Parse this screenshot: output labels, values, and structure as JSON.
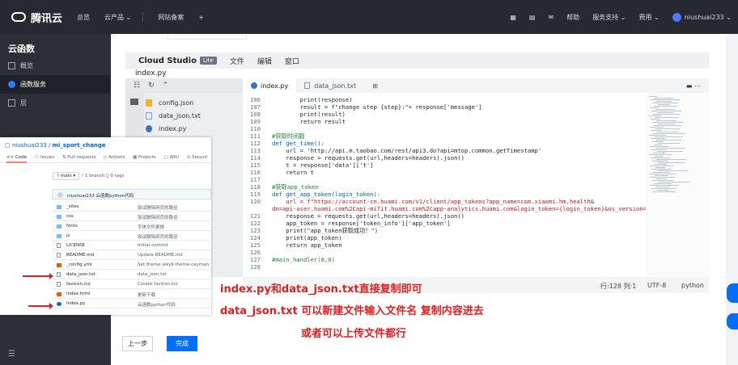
{
  "topbar": {
    "brand": "腾讯云",
    "nav": [
      "总览",
      "云产品 ⌄",
      "网站备案",
      "+"
    ],
    "right": [
      "帮助",
      "服务支持 ⌄",
      "费用 ⌄"
    ],
    "user": "niushuai233 ⌄"
  },
  "sidebar": {
    "title": "云函数",
    "items": [
      {
        "label": "概览"
      },
      {
        "label": "函数服务"
      },
      {
        "label": "层"
      }
    ]
  },
  "studio": {
    "brand": "Cloud Studio",
    "badge": "Lite",
    "menu": [
      "文件",
      "编辑",
      "窗口"
    ],
    "path": "index.py",
    "files": [
      "config.json",
      "data_json.txt",
      "index.py"
    ],
    "tabs": [
      "index.py",
      "data_json.txt"
    ],
    "code": [
      {
        "n": "106",
        "t": "        print(response)",
        "k": ""
      },
      {
        "n": "107",
        "t": "        result = f\"change step {step}:\"+ response['message']",
        "k": ""
      },
      {
        "n": "108",
        "t": "        print(result)",
        "k": ""
      },
      {
        "n": "109",
        "t": "        return result",
        "k": ""
      },
      {
        "n": "110",
        "t": "",
        "k": ""
      },
      {
        "n": "111",
        "t": "#获取时间戳",
        "k": "comment"
      },
      {
        "n": "112",
        "t": "def get_time():",
        "k": "kw"
      },
      {
        "n": "113",
        "t": "    url = 'http://api.m.taobao.com/rest/api3.do?api=mtop.common.getTimestamp'",
        "k": ""
      },
      {
        "n": "114",
        "t": "    response = requests.get(url,headers=headers).json()",
        "k": ""
      },
      {
        "n": "115",
        "t": "    t = response['data']['t']",
        "k": ""
      },
      {
        "n": "116",
        "t": "    return t",
        "k": ""
      },
      {
        "n": "117",
        "t": "",
        "k": ""
      },
      {
        "n": "118",
        "t": "#获取app_token",
        "k": "comment"
      },
      {
        "n": "119",
        "t": "def get_app_token(login_token):",
        "k": "kw"
      },
      {
        "n": "120",
        "t": "    url = f\"https://account-cn.huami.com/v1/client/app_tokens?app_name=com.xiaomi.hm.health&",
        "k": "str"
      },
      {
        "n": "",
        "t": "dn=api-user.huami.com%2Capi-mifit.huami.com%2Capp-analytics.huami.com&login_token={login_token}&os_version=4.1.0\"",
        "k": "str"
      },
      {
        "n": "121",
        "t": "    response = requests.get(url,headers=headers).json()",
        "k": ""
      },
      {
        "n": "122",
        "t": "    app_token = response['token_info']['app_token']",
        "k": ""
      },
      {
        "n": "123",
        "t": "    print(\"app_token获取成功！\")",
        "k": ""
      },
      {
        "n": "124",
        "t": "    print(app_token)",
        "k": ""
      },
      {
        "n": "125",
        "t": "    return app_token",
        "k": ""
      },
      {
        "n": "126",
        "t": "",
        "k": ""
      },
      {
        "n": "127",
        "t": "#main_handler(0,0)",
        "k": "comment"
      },
      {
        "n": "128",
        "t": "",
        "k": ""
      }
    ],
    "status": {
      "position": "行:128 列:1",
      "encoding": "UTF-8",
      "language": "python"
    }
  },
  "github": {
    "owner": "niushuai233",
    "repo": "mi_sport_change",
    "tabs": [
      "<> Code",
      "ⓘ Issues",
      "⇅ Pull requests",
      "▷ Actions",
      "▦ Projects",
      "▢ Wiki",
      "⊙ Securit"
    ],
    "branch": "ᚹ main ▾",
    "branch_info": "ᚹ 1 branch   ⃝ 0 tags",
    "commit": "niushuai233 云函数python代码",
    "files": [
      {
        "name": "_sites",
        "msg": "尝试删除网页的路径",
        "kind": "dir"
      },
      {
        "name": "css",
        "msg": "尝试删除网页的路径",
        "kind": "dir"
      },
      {
        "name": "fonts",
        "msg": "字体文件更换",
        "kind": "dir"
      },
      {
        "name": "js",
        "msg": "尝试删除网页的路径",
        "kind": "dir"
      },
      {
        "name": "LICENSE",
        "msg": "Initial commit",
        "kind": "file"
      },
      {
        "name": "README.md",
        "msg": "Update README.md",
        "kind": "file"
      },
      {
        "name": "_config.yml",
        "msg": "Set theme jekyll-theme-cayman",
        "kind": "red"
      },
      {
        "name": "data_json.txt",
        "msg": "data_json.txt",
        "kind": "file"
      },
      {
        "name": "favicon.ico",
        "msg": "Create favicon.ico",
        "kind": "file"
      },
      {
        "name": "index.html",
        "msg": "更新下载",
        "kind": "red"
      },
      {
        "name": "index.py",
        "msg": "云函数python代码",
        "kind": "blue"
      }
    ]
  },
  "annotations": {
    "line1": "index.py和data_json.txt直接复制即可",
    "line2": "data_json.txt  可以新建文件输入文件名 复制内容进去",
    "line3": "或者可以上传文件都行"
  },
  "buttons": {
    "prev": "上一步",
    "done": "完成"
  },
  "colors": {
    "accent": "#006eff",
    "annotation": "#e02020",
    "topbar": "#262a30"
  }
}
